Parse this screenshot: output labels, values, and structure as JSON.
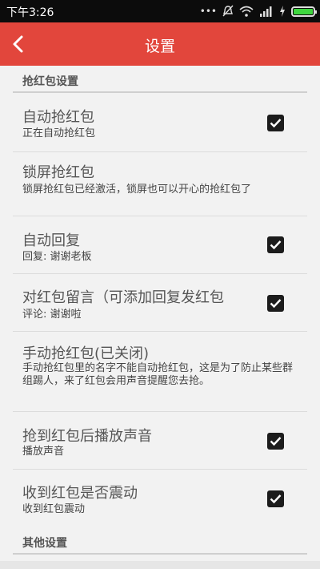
{
  "status": {
    "time": "下午3:26",
    "dots": "•••"
  },
  "appbar": {
    "title": "设置"
  },
  "sections": {
    "grab": "抢红包设置",
    "other": "其他设置"
  },
  "items": [
    {
      "title": "自动抢红包",
      "subtitle": "正在自动抢红包",
      "checked": true
    },
    {
      "title": "锁屏抢红包",
      "subtitle": "锁屏抢红包已经激活，锁屏也可以开心的抢红包了",
      "checked": false
    },
    {
      "title": "自动回复",
      "subtitle": "回复: 谢谢老板",
      "checked": true
    },
    {
      "title": "对红包留言（可添加回复发红包",
      "subtitle": "评论: 谢谢啦",
      "checked": true
    },
    {
      "title": "手动抢红包(已关闭)",
      "subtitle": "手动抢红包里的名字不能自动抢红包，这是为了防止某些群组踢人，来了红包会用声音提醒您去抢。",
      "checked": false
    },
    {
      "title": "抢到红包后播放声音",
      "subtitle": "播放声音",
      "checked": true
    },
    {
      "title": "收到红包是否震动",
      "subtitle": "收到红包震动",
      "checked": true
    }
  ],
  "colors": {
    "appbar": "#e2463c",
    "statusbar": "#0c0c0c",
    "battery": "#3fd63f"
  }
}
